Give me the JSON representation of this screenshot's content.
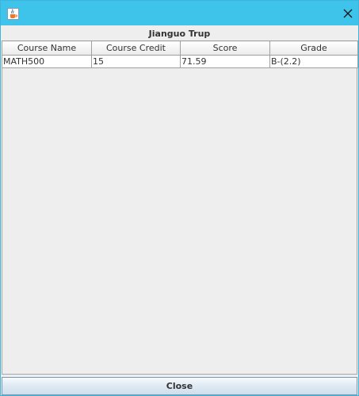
{
  "window": {
    "title": "",
    "titlebar_color": "#3ec3ea"
  },
  "header": {
    "title": "Jianguo Trup"
  },
  "table": {
    "columns": [
      "Course Name",
      "Course Credit",
      "Score",
      "Grade"
    ],
    "rows": [
      [
        "MATH500",
        "15",
        "71.59",
        "B-(2.2)"
      ]
    ]
  },
  "footer": {
    "close_label": "Close"
  },
  "icons": {
    "app": "java-cup-icon",
    "window_close": "close-icon"
  }
}
